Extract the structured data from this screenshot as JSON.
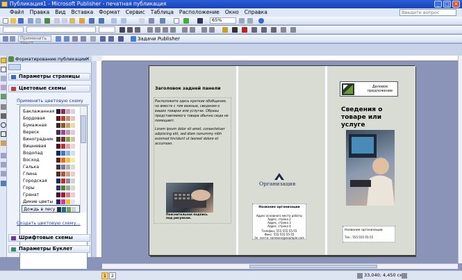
{
  "window": {
    "title": "Публикация1 - Microsoft Publisher - печатная публикация",
    "buttons": [
      "_",
      "□",
      "✕"
    ]
  },
  "menu": [
    "Файл",
    "Правка",
    "Вид",
    "Вставка",
    "Формат",
    "Сервис",
    "Таблица",
    "Расположение",
    "Окно",
    "Справка"
  ],
  "ask_placeholder": "Введите вопрос",
  "toolbar": {
    "zoom": "65%",
    "apply_text": "Применить текст...",
    "tasks_label": "Задачи Publisher"
  },
  "taskpane": {
    "title": "Форматирование публикации",
    "sections": {
      "page_params": "Параметры страницы",
      "color_schemes": "Цветовые схемы",
      "font_schemes": "Шрифтовые схемы",
      "booklet_params": "Параметры Буклет"
    },
    "apply_label": "Применить цветовую схему",
    "create_link": "Создать цветовую схему...",
    "schemes": [
      {
        "name": "Баклажанная",
        "colors": [
          "#2b1a3b",
          "#8a2f5a",
          "#c8a2b8",
          "#e0d0dc"
        ]
      },
      {
        "name": "Бордовая",
        "colors": [
          "#6a1020",
          "#a84a3a",
          "#c89070",
          "#e0c8b8"
        ]
      },
      {
        "name": "Бумажная",
        "colors": [
          "#3a2a18",
          "#8a5a2a",
          "#c8a060",
          "#e8d8b0"
        ]
      },
      {
        "name": "Вереск",
        "colors": [
          "#4a2a5a",
          "#9a4a8a",
          "#c890b8",
          "#e0c8d8"
        ]
      },
      {
        "name": "Виноградник",
        "colors": [
          "#2a3a1a",
          "#7a2a4a",
          "#8aa040",
          "#c8c8a0"
        ]
      },
      {
        "name": "Вишневая",
        "colors": [
          "#5a0a1a",
          "#c82a3a",
          "#e8a0a8",
          "#f0d0d0"
        ]
      },
      {
        "name": "Водопад",
        "colors": [
          "#0a2a6a",
          "#3a7ac8",
          "#8ab8e0",
          "#c8e0f0"
        ]
      },
      {
        "name": "Восход",
        "colors": [
          "#6a1a0a",
          "#e86a1a",
          "#f0c040",
          "#f8e8a0"
        ]
      },
      {
        "name": "Галька",
        "colors": [
          "#3a3a4a",
          "#7a7a8a",
          "#b0b0b8",
          "#d8d8e0"
        ]
      },
      {
        "name": "Глина",
        "colors": [
          "#5a2a1a",
          "#a85a3a",
          "#d0a080",
          "#e8d0c0"
        ]
      },
      {
        "name": "Городская",
        "colors": [
          "#1a2a5a",
          "#c82a2a",
          "#8a8a9a",
          "#d0d0d8"
        ]
      },
      {
        "name": "Горы",
        "colors": [
          "#2a3a5a",
          "#5a7a3a",
          "#a0a890",
          "#d8d8c8"
        ]
      },
      {
        "name": "Гранат",
        "colors": [
          "#4a0a2a",
          "#a01a3a",
          "#d87a8a",
          "#f0c8d0"
        ]
      },
      {
        "name": "Дикие цветы",
        "colors": [
          "#3a1a6a",
          "#d83a8a",
          "#f0c02a",
          "#e8e0f0"
        ]
      },
      {
        "name": "Дождь в лесу",
        "colors": [
          "#1a3a2a",
          "#2a6a8a",
          "#7aa060",
          "#c8d8c0"
        ]
      }
    ]
  },
  "brochure": {
    "back_title": "Заголовок задней панели",
    "back_body": "Расположите здесь краткие обобщения, но вместе с тем важные, сведения о ваших товарах или услугах. Образы представляемого товара обычно сюда не помещают.",
    "back_latin": "Lorem ipsum dolor sit amet, consectetuer adipiscing elit, sed diam nonummy nibh euismod tincidunt ut laoreet dolore et accumsan.",
    "caption": "Пояснительная подпись под рисунком.",
    "org": "Организация",
    "org_name": "Название организации",
    "addr": [
      "Адрес основного места работы",
      "Адрес, строка 2",
      "Адрес, строка 3",
      "Адрес, строка 4"
    ],
    "phone": "Телефон: 555-555-55-55",
    "fax": "Факс: 555-555-55-55",
    "email": "Эл. почта: someone@example.com",
    "logo_text": "Деловое предложение",
    "cover_title": "Сведения о товаре или услуге",
    "cover_org": "Название организации",
    "cover_phone": "Тел.: 555-555-55-55"
  },
  "status": {
    "pages": [
      "1",
      "2"
    ],
    "coords": "33,040; 4,450 см"
  }
}
